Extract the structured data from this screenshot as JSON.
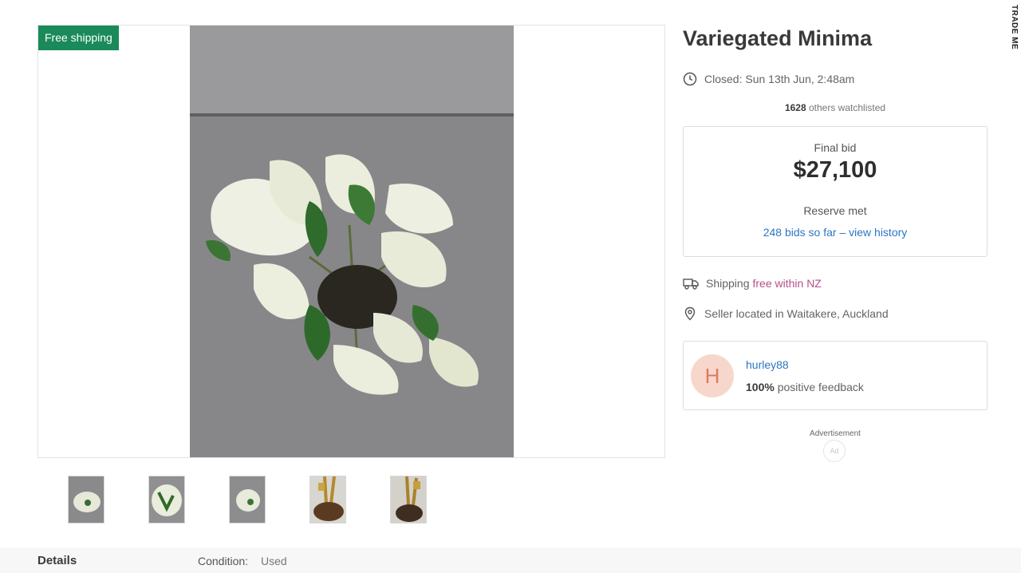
{
  "brand": "TRADE ME",
  "gallery": {
    "badge": "Free shipping",
    "thumbnails": [
      {
        "name": "thumbnail-1"
      },
      {
        "name": "thumbnail-2"
      },
      {
        "name": "thumbnail-3"
      },
      {
        "name": "thumbnail-4"
      },
      {
        "name": "thumbnail-5"
      }
    ]
  },
  "listing": {
    "title": "Variegated Minima",
    "closed": "Closed: Sun 13th Jun, 2:48am",
    "watchlist_count": "1628",
    "watchlist_text": " others watchlisted"
  },
  "bid": {
    "label": "Final bid",
    "amount": "$27,100",
    "reserve": "Reserve met",
    "bids_link": "248 bids so far – view history"
  },
  "shipping": {
    "label": "Shipping",
    "value": "free within NZ"
  },
  "location": "Seller located in Waitakere, Auckland",
  "seller": {
    "initial": "H",
    "username": "hurley88",
    "feedback_percent": "100%",
    "feedback_text": " positive feedback"
  },
  "ad": {
    "label": "Advertisement",
    "icon_text": "Ad"
  },
  "details": {
    "title": "Details",
    "condition_label": "Condition:",
    "condition_value": "Used"
  },
  "colors": {
    "badge": "#1a8a5a",
    "link": "#2c76c2",
    "shipping_free": "#b4508a",
    "avatar_bg": "#f7d7cc"
  }
}
